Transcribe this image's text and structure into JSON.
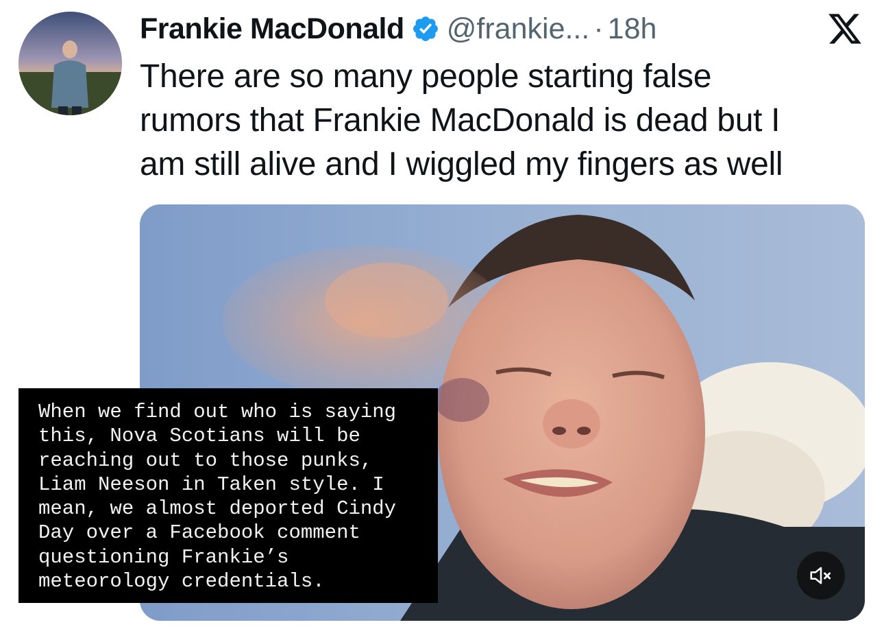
{
  "tweet": {
    "display_name": "Frankie MacDonald",
    "handle": "@frankie...",
    "separator": "·",
    "time": "18h",
    "text_lines": [
      "There are so many people starting false",
      "rumors that Frankie MacDonald is dead but I",
      "am still alive and I wiggled my fingers as well"
    ],
    "verified_icon": "verified-badge-icon",
    "platform_logo": "x-logo-icon"
  },
  "media": {
    "type": "video",
    "mute_icon": "speaker-muted-icon"
  },
  "caption": {
    "lines": [
      "When we find out who is saying",
      "this, Nova Scotians will be",
      "reaching out to those punks,",
      "Liam Neeson in Taken style. I",
      "mean, we almost deported Cindy",
      "Day over a Facebook comment",
      "questioning Frankie’s",
      "meteorology credentials."
    ]
  },
  "colors": {
    "text_primary": "#0f1419",
    "text_secondary": "#536471",
    "verified_blue": "#1d9bf0",
    "caption_bg": "#000000",
    "caption_text": "#f2f2f2"
  }
}
